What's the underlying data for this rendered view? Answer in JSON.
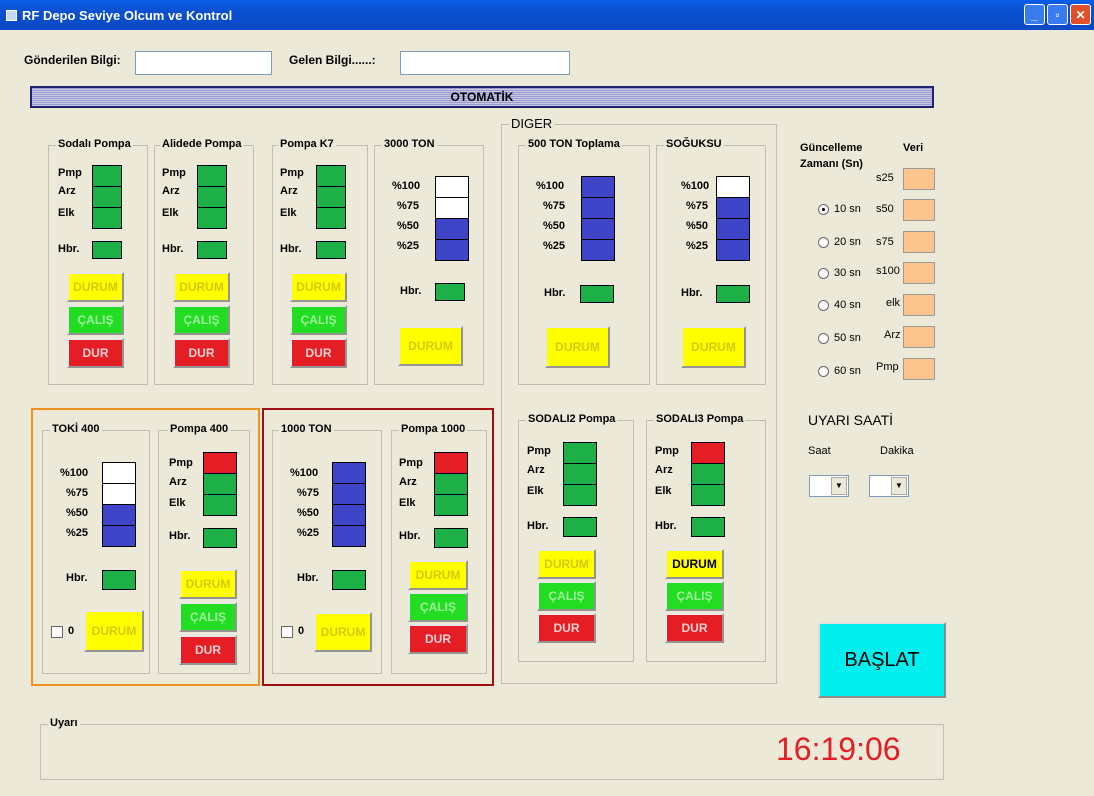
{
  "window": {
    "title": "RF Depo Seviye Olcum ve Kontrol"
  },
  "top": {
    "sent_label": "Gönderilen Bilgi:",
    "sent_value": "",
    "recv_label": "Gelen Bilgi......:",
    "recv_value": ""
  },
  "banner": "OTOMATİK",
  "labels": {
    "pmp": "Pmp",
    "arz": "Arz",
    "elk": "Elk",
    "hbr": "Hbr.",
    "p100": "%100",
    "p75": "%75",
    "p50": "%50",
    "p25": "%25"
  },
  "buttons": {
    "durum": "DURUM",
    "calis": "ÇALIŞ",
    "dur": "DUR"
  },
  "panels": {
    "sodali_pompa": "Sodalı Pompa",
    "alidede_pompa": "Alidede Pompa",
    "pompa_k7": "Pompa K7",
    "ton3000": "3000 TON",
    "diger": "DIGER",
    "ton500": "500 TON Toplama",
    "soguksu": "SOĞUKSU",
    "toki400": "TOKİ 400",
    "pompa400": "Pompa 400",
    "ton1000": "1000 TON",
    "pompa1000": "Pompa 1000",
    "sodali2": "SODALI2 Pompa",
    "sodali3": "SODALI3 Pompa"
  },
  "checkbox_value": "0",
  "update": {
    "title_line1": "Güncelleme",
    "title_line2": "Zamanı (Sn)",
    "veri": "Veri",
    "options": [
      "10 sn",
      "20 sn",
      "30 sn",
      "40 sn",
      "50 sn",
      "60 sn"
    ],
    "selected": "10 sn",
    "fields": [
      "s25",
      "s50",
      "s75",
      "s100",
      "elk",
      "Arz",
      "Pmp"
    ]
  },
  "alarm": {
    "title": "UYARI SAATİ",
    "saat": "Saat",
    "dakika": "Dakika"
  },
  "start_button": "BAŞLAT",
  "warning_label": "Uyarı",
  "clock": "16:19:06",
  "colors": {
    "green": "#1db046",
    "red": "#e51e25",
    "blue": "#3d44c8",
    "yellow": "#ffff00",
    "cyan": "#00f0f0",
    "orange_frame": "#f0901e",
    "red_frame": "#a01010"
  }
}
